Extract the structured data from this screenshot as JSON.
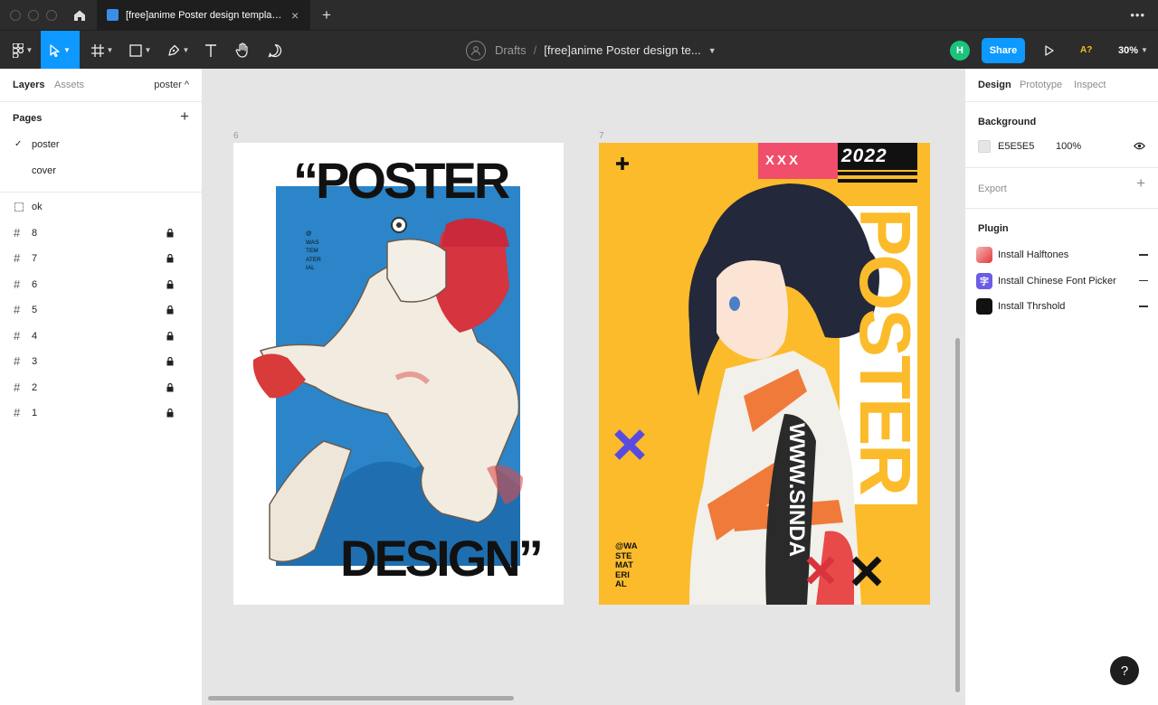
{
  "window": {
    "tab_title": "[free]anime Poster design template ...",
    "tab_close": "×",
    "new_tab": "+",
    "menu": "•••"
  },
  "toolbar": {
    "breadcrumb_drafts": "Drafts",
    "breadcrumb_sep": "/",
    "file_name": "[free]anime Poster design te...",
    "user_initial": "H",
    "share_label": "Share",
    "font_warning": "A?",
    "zoom": "30%"
  },
  "left_panel": {
    "tabs": [
      "Layers",
      "Assets"
    ],
    "current_page": "poster ^",
    "pages_title": "Pages",
    "pages": [
      {
        "name": "poster",
        "check": "✓"
      },
      {
        "name": "cover",
        "check": ""
      }
    ],
    "layers": [
      {
        "name": "ok",
        "locked": false
      },
      {
        "name": "8",
        "locked": true
      },
      {
        "name": "7",
        "locked": true
      },
      {
        "name": "6",
        "locked": true
      },
      {
        "name": "5",
        "locked": true
      },
      {
        "name": "4",
        "locked": true
      },
      {
        "name": "3",
        "locked": true
      },
      {
        "name": "2",
        "locked": true
      },
      {
        "name": "1",
        "locked": true
      }
    ]
  },
  "canvas": {
    "frame6": {
      "label": "6",
      "title_top": "“POSTER",
      "title_bottom": "DESIGN”",
      "credit": [
        "@",
        "WAS",
        "TEM",
        "ATER",
        "IAL"
      ]
    },
    "frame7": {
      "label": "7",
      "tag": "XXX",
      "year": "2022",
      "vertical_title": "POSTER",
      "credit": [
        "@WA",
        "STE",
        "MAT",
        "ERI",
        "AL"
      ],
      "plus": "+",
      "sash_text": "WWW.SINDA"
    }
  },
  "right_panel": {
    "tabs": [
      "Design",
      "Prototype",
      "Inspect"
    ],
    "background_title": "Background",
    "background_hex": "E5E5E5",
    "background_opacity": "100%",
    "export_title": "Export",
    "plugin_title": "Plugin",
    "plugins": [
      {
        "name": "Install Halftones",
        "icon": "",
        "color": "#e84040"
      },
      {
        "name": "Install Chinese Font Picker",
        "icon": "字",
        "color": "#6b5ce7"
      },
      {
        "name": "Install Thrshold",
        "icon": "",
        "color": "#111111"
      }
    ],
    "help": "?"
  },
  "colors": {
    "accent": "#0d99ff",
    "poster_yellow": "#fbbb2b",
    "poster_blue": "#2b85c8",
    "poster_pink": "#f04e6a"
  }
}
